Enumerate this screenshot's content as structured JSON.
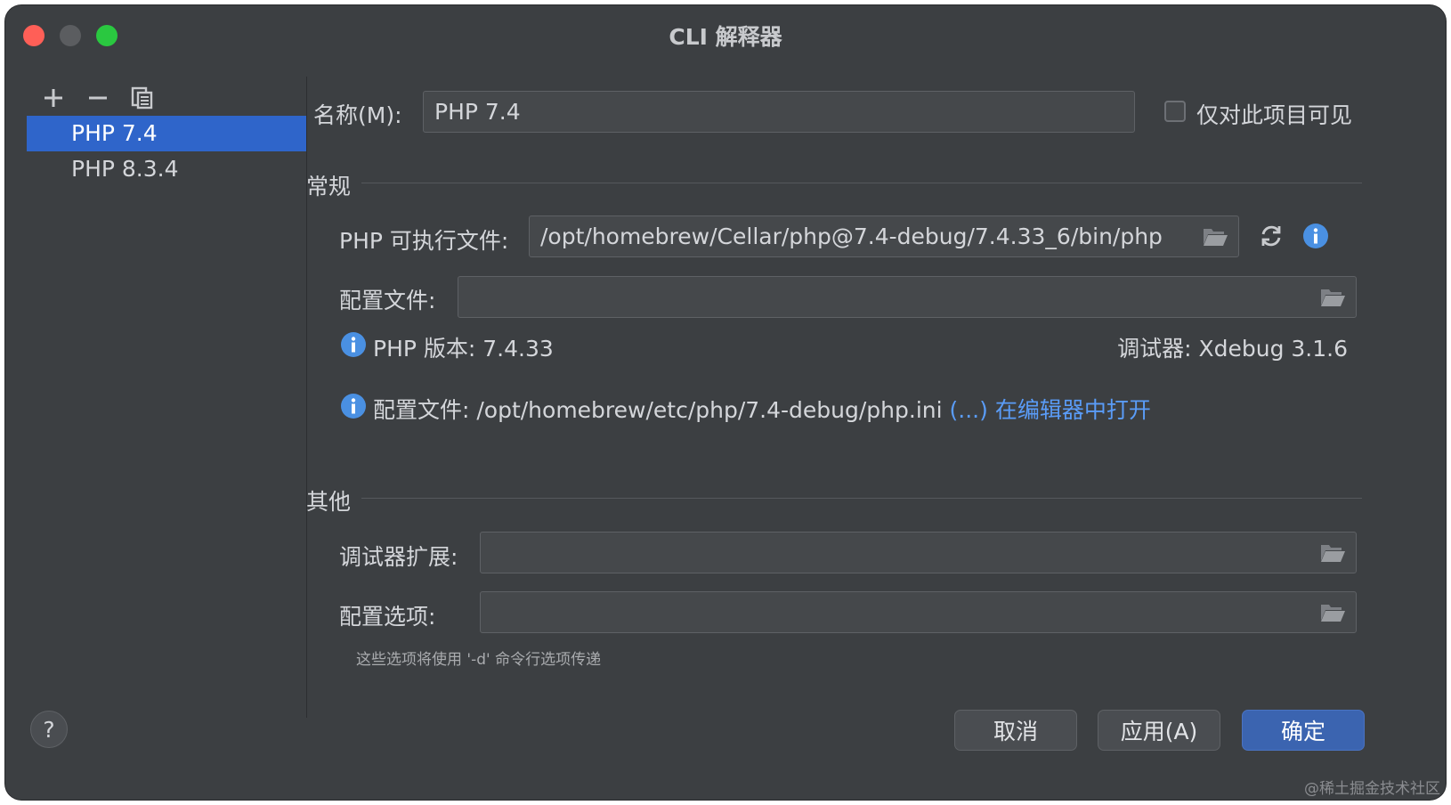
{
  "window": {
    "title": "CLI 解释器"
  },
  "toolbar": {
    "add_icon": "plus-icon",
    "remove_icon": "minus-icon",
    "copy_icon": "copy-icon"
  },
  "sidebar": {
    "items": [
      {
        "label": "PHP 7.4",
        "selected": true
      },
      {
        "label": "PHP 8.3.4",
        "selected": false
      }
    ]
  },
  "name_row": {
    "label": "名称(M):",
    "value": "PHP 7.4",
    "visible_only_label": "仅对此项目可见",
    "visible_only_checked": false
  },
  "general": {
    "title": "常规",
    "executable_label": "PHP 可执行文件:",
    "executable_value": "/opt/homebrew/Cellar/php@7.4-debug/7.4.33_6/bin/php",
    "config_file_label": "配置文件:",
    "config_file_value": "",
    "php_version": "PHP 版本: 7.4.33",
    "debugger": "调试器: Xdebug 3.1.6",
    "config_info_prefix": "配置文件: /opt/homebrew/etc/php/7.4-debug/php.ini",
    "config_info_more": "(...)",
    "open_in_editor": "在编辑器中打开"
  },
  "other": {
    "title": "其他",
    "debugger_ext_label": "调试器扩展:",
    "debugger_ext_value": "",
    "config_options_label": "配置选项:",
    "config_options_value": "",
    "hint": "这些选项将使用 '-d' 命令行选项传递"
  },
  "buttons": {
    "help": "?",
    "cancel": "取消",
    "apply": "应用(A)",
    "ok": "确定"
  },
  "icons": {
    "folder": "folder-icon",
    "refresh": "refresh-icon",
    "info": "info-icon"
  },
  "colors": {
    "accent": "#2f65ca",
    "link": "#5a9cf8",
    "info": "#4a90e2"
  },
  "watermark": "@稀土掘金技术社区"
}
